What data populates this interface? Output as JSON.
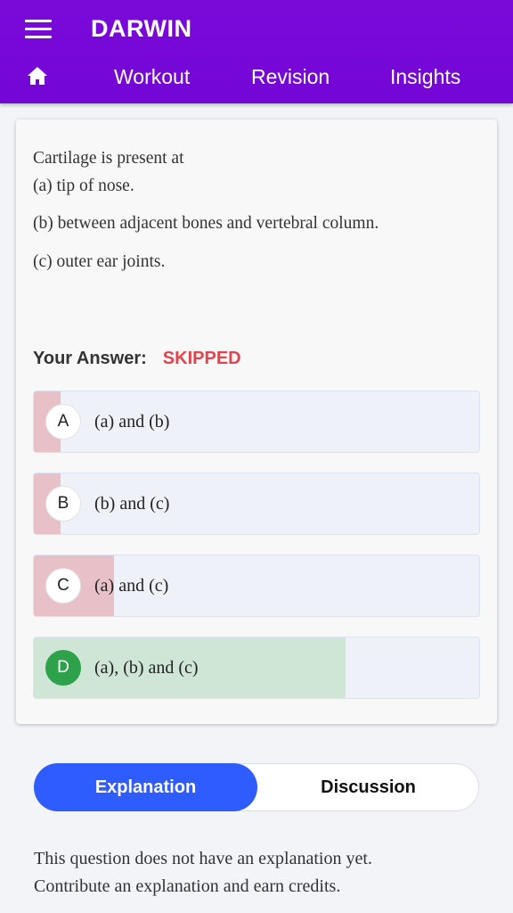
{
  "header": {
    "title": "DARWIN",
    "menu_icon": "hamburger-menu-icon",
    "home_icon": "home-icon",
    "nav": [
      "Workout",
      "Revision",
      "Insights"
    ],
    "accent": "#7408d6"
  },
  "question": {
    "lines": [
      "Cartilage is present at",
      "(a) tip of nose.",
      "(b) between adjacent bones and vertebral column.",
      "(c) outer ear joints."
    ]
  },
  "answer": {
    "label": "Your Answer:",
    "value": "SKIPPED",
    "value_color": "#e0454d"
  },
  "options": [
    {
      "letter": "A",
      "text": "(a) and (b)",
      "fill_fraction": 0.06,
      "fill_color": "#e8c0c8",
      "correct": false
    },
    {
      "letter": "B",
      "text": "(b) and (c)",
      "fill_fraction": 0.06,
      "fill_color": "#e8c0c8",
      "correct": false
    },
    {
      "letter": "C",
      "text": "(a) and (c)",
      "fill_fraction": 0.18,
      "fill_color": "#e8c0c8",
      "correct": false
    },
    {
      "letter": "D",
      "text": "(a), (b) and (c)",
      "fill_fraction": 0.7,
      "fill_color": "#cfe5d6",
      "correct": true
    }
  ],
  "tabs": {
    "explanation": "Explanation",
    "discussion": "Discussion",
    "active": "explanation",
    "active_color": "#2f5cff"
  },
  "explanation": {
    "lines": [
      "This question does not have an explanation yet.",
      "Contribute an explanation and earn credits."
    ]
  }
}
